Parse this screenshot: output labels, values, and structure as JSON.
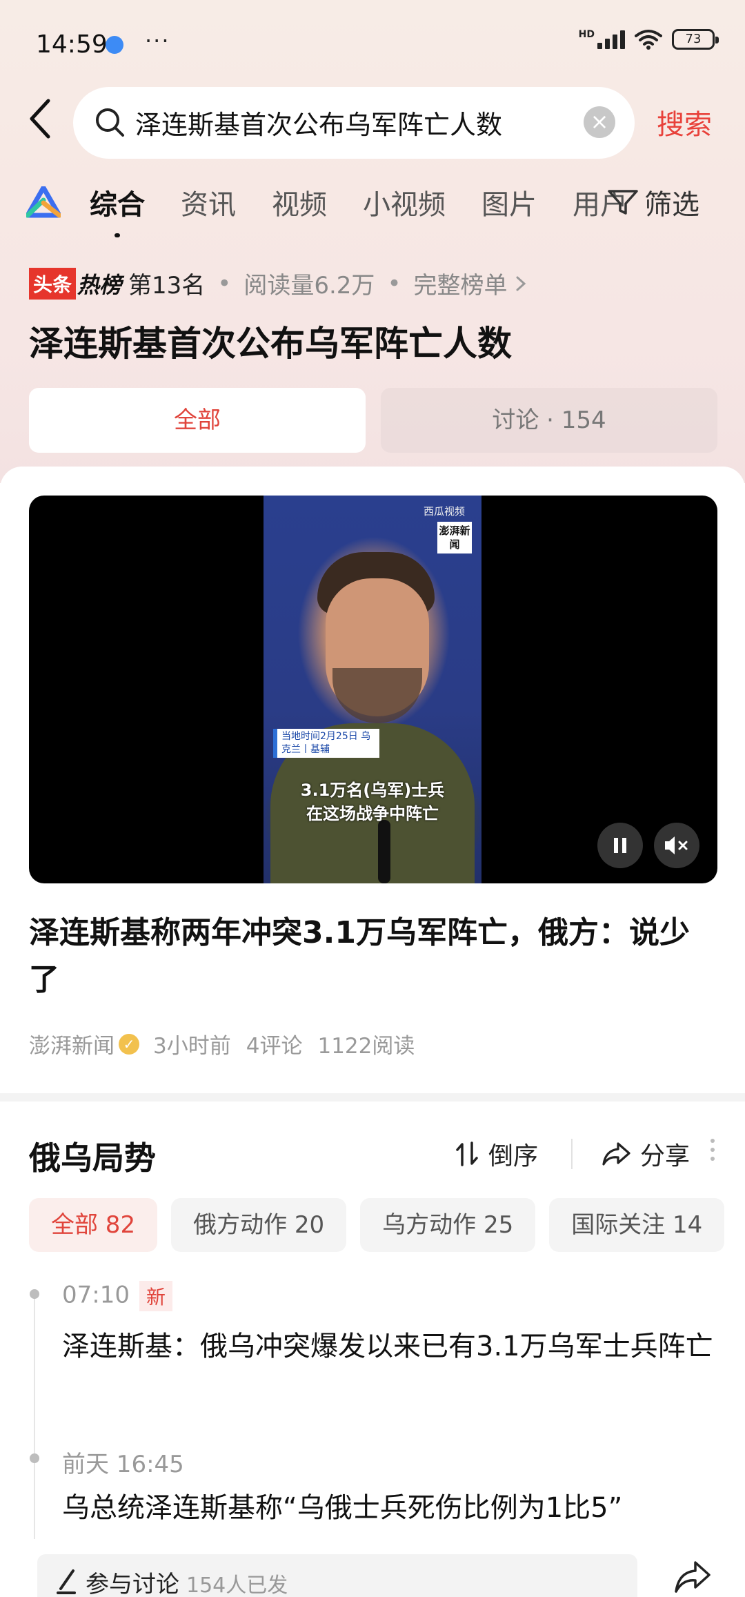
{
  "status_bar": {
    "time": "14:59",
    "more": "···",
    "network": "HD",
    "battery": "73"
  },
  "search": {
    "query": "泽连斯基首次公布乌军阵亡人数",
    "submit_label": "搜索"
  },
  "tabs": [
    {
      "label": "综合",
      "active": true
    },
    {
      "label": "资讯",
      "active": false
    },
    {
      "label": "视频",
      "active": false
    },
    {
      "label": "小视频",
      "active": false
    },
    {
      "label": "图片",
      "active": false
    },
    {
      "label": "用户",
      "active": false
    }
  ],
  "filter_label": "筛选",
  "hot": {
    "badge_a": "头条",
    "badge_b": "热榜",
    "rank": "第13名",
    "reads": "阅读量6.2万",
    "full_list": "完整榜单",
    "title": "泽连斯基首次公布乌军阵亡人数"
  },
  "segments": {
    "all": "全部",
    "discuss": "讨论 · 154"
  },
  "video": {
    "watermark_logo": "西瓜视频",
    "watermark_box": "澎湃新闻",
    "location_tag": "当地时间2月25日 乌克兰丨基辅",
    "subtitle_line1": "3.1万名(乌军)士兵",
    "subtitle_line2": "在这场战争中阵亡"
  },
  "article": {
    "title": "泽连斯基称两年冲突3.1万乌军阵亡，俄方：说少了",
    "source": "澎湃新闻",
    "time": "3小时前",
    "comments": "4评论",
    "reads": "1122阅读"
  },
  "topic": {
    "title": "俄乌局势",
    "sort_label": "倒序",
    "share_label": "分享",
    "chips": [
      {
        "label": "全部 82",
        "active": true
      },
      {
        "label": "俄方动作 20",
        "active": false
      },
      {
        "label": "乌方动作 25",
        "active": false
      },
      {
        "label": "国际关注 14",
        "active": false
      }
    ],
    "timeline": [
      {
        "time": "07:10",
        "badge": "新",
        "text": "泽连斯基：俄乌冲突爆发以来已有3.1万乌军士兵阵亡"
      },
      {
        "time": "前天 16:45",
        "badge": "",
        "text": "乌总统泽连斯基称“乌俄士兵死伤比例为1比5”"
      }
    ]
  },
  "bottom": {
    "discuss_label": "参与讨论",
    "discuss_count": "154人已发"
  },
  "colors": {
    "accent": "#e0443b",
    "background_top": "#f7ece6"
  }
}
